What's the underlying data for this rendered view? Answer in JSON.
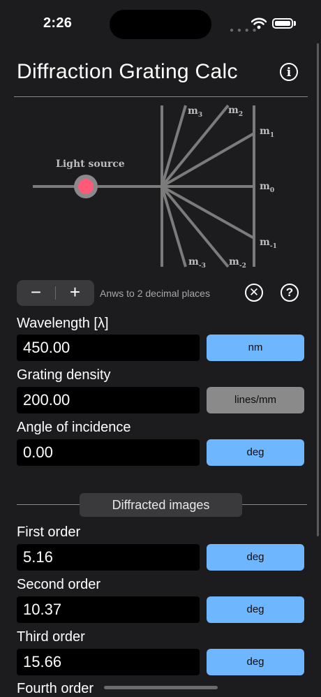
{
  "status_bar": {
    "time": "2:26"
  },
  "header": {
    "title": "Diffraction Grating Calc",
    "info_icon_glyph": "i"
  },
  "diagram": {
    "light_source_label": "Light source",
    "order_labels": [
      {
        "base": "m",
        "sub": "3"
      },
      {
        "base": "m",
        "sub": "2"
      },
      {
        "base": "m",
        "sub": "1"
      },
      {
        "base": "m",
        "sub": "0"
      },
      {
        "base": "m",
        "sub": "-1"
      },
      {
        "base": "m",
        "sub": "-2"
      },
      {
        "base": "m",
        "sub": "-3"
      }
    ],
    "source_color": "#ff5a78"
  },
  "controls": {
    "minus_label": "−",
    "plus_label": "+",
    "precision_text": "Anws to 2 decimal places",
    "clear_glyph": "✕",
    "help_glyph": "?"
  },
  "inputs": {
    "wavelength": {
      "label": "Wavelength [λ]",
      "value": "450.00",
      "unit": "nm"
    },
    "grating_density": {
      "label": "Grating density",
      "value": "200.00",
      "unit": "lines/mm"
    },
    "angle_of_incidence": {
      "label": "Angle of incidence",
      "value": "0.00",
      "unit": "deg"
    }
  },
  "results": {
    "section_title": "Diffracted images",
    "first": {
      "label": "First order",
      "value": "5.16",
      "unit": "deg"
    },
    "second": {
      "label": "Second order",
      "value": "10.37",
      "unit": "deg"
    },
    "third": {
      "label": "Third order",
      "value": "15.66",
      "unit": "deg"
    },
    "fourth": {
      "label": "Fourth order"
    }
  },
  "colors": {
    "background": "#1c1c1e",
    "unit_active": "#6eb7ff",
    "unit_inactive": "#8a8a8a",
    "field": "#000000"
  }
}
